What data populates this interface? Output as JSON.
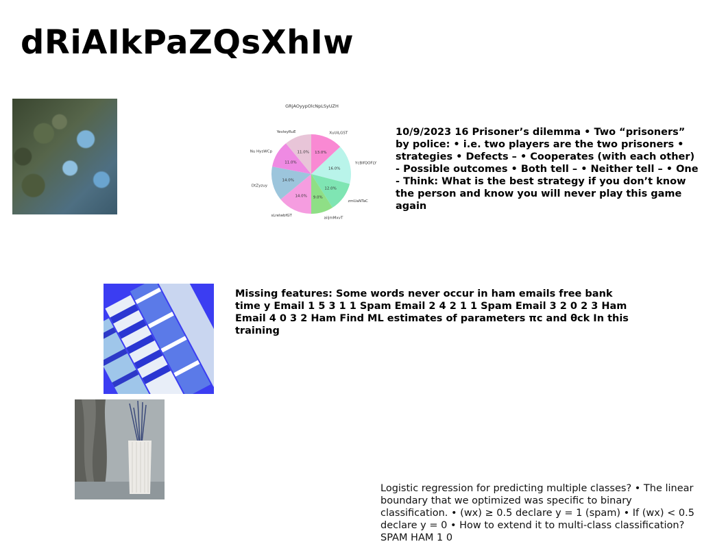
{
  "page": {
    "title": "dRiAIkPaZQsXhIw"
  },
  "texts": {
    "prisoner": "10/9/2023 16 Prisoner’s dilemma • Two “prisoners” by police: • i.e. two players are the two prisoners • strategies • Defects – • Cooperates (with each other) - Possible outcomes • Both tell – • Neither tell – • One - Think: What is the best strategy if you don’t know the person and know you will never play this game again",
    "missing": "Missing features: Some words never occur in ham emails free bank time y Email 1 5 3 1 1 Spam Email 2 4 2 1 1 Spam Email 3 2 0 2 3 Ham Email 4 0 3 2 Ham Find ML estimates of parameters πc and θck In this training",
    "logistic": "Logistic regression for predicting multiple classes? • The linear boundary that we optimized was specific to binary classification. • (wx) ≥ 0.5 declare y = 1 (spam) • If (wx) < 0.5 declare y = 0 • How to extend it to multi-class classification? SPAM HAM 1 0"
  },
  "chart_data": {
    "type": "pie",
    "title": "GRjAOyypOlcNpLSyUZH",
    "slices": [
      {
        "label": "XuUiLGST",
        "value": 13.0,
        "pct_label": "13.0%",
        "color": "#f989d3"
      },
      {
        "label": "YcBIfQOFLY",
        "value": 16.0,
        "pct_label": "16.0%",
        "color": "#b9f4ea"
      },
      {
        "label": "zmUaNTaC",
        "value": 12.0,
        "pct_label": "12.0%",
        "color": "#7fe5b3"
      },
      {
        "label": "aiijmMxvT",
        "value": 9.0,
        "pct_label": "9.0%",
        "color": "#8fdf86"
      },
      {
        "label": "sLrelwbfGT",
        "value": 14.0,
        "pct_label": "14.0%",
        "color": "#f59de0"
      },
      {
        "label": "DtZyzuy",
        "value": 14.0,
        "pct_label": "14.0%",
        "color": "#9cc5dc"
      },
      {
        "label": "Nu HysWCp",
        "value": 11.0,
        "pct_label": "11.0%",
        "color": "#ef8ae3"
      },
      {
        "label": "YevleyRuE",
        "value": 11.0,
        "pct_label": "11.0%",
        "color": "#e8c5d8"
      }
    ],
    "start_angle_deg": 90,
    "direction": "clockwise"
  }
}
